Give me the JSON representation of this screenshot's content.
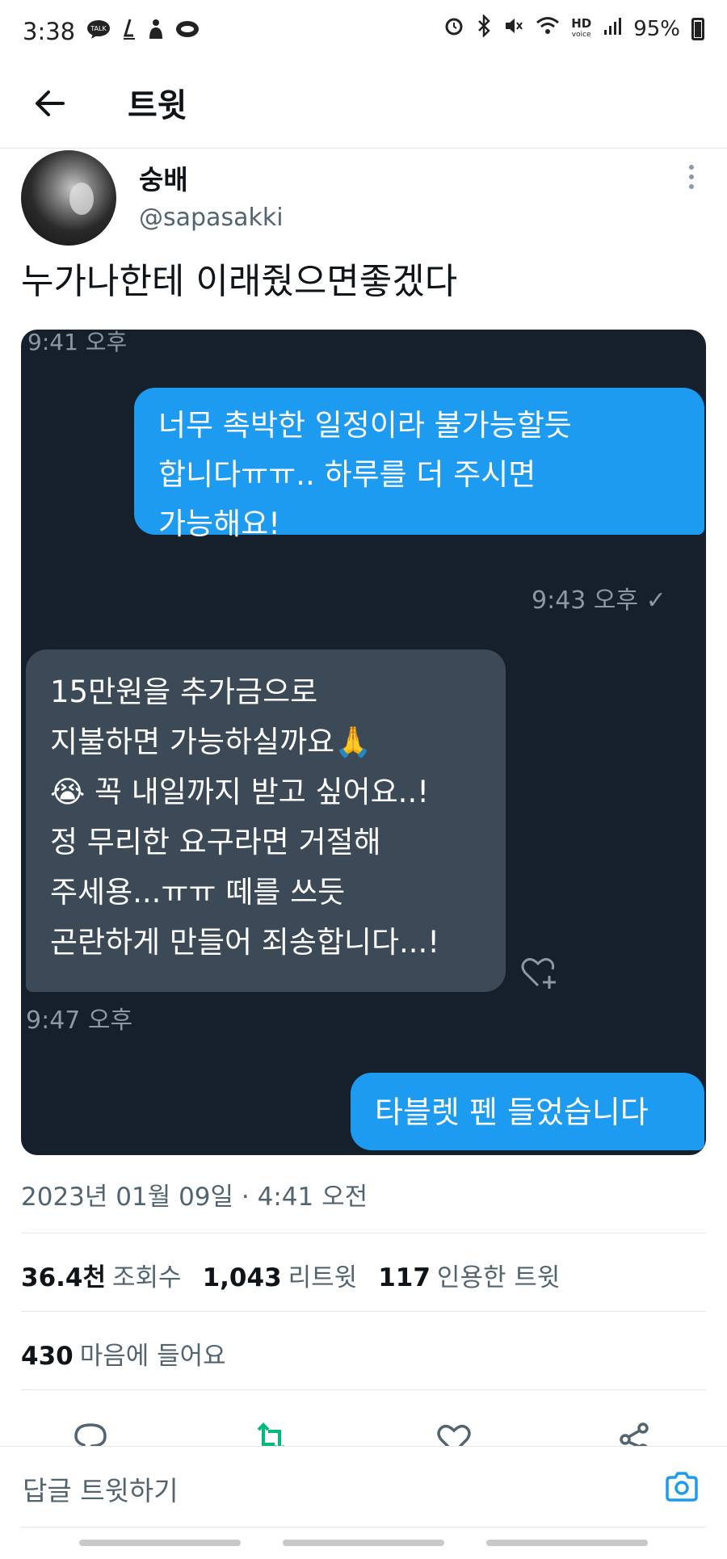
{
  "status_bar": {
    "time": "3:38",
    "left_icons": [
      "talk-icon",
      "l-icon",
      "person-icon",
      "bubble-icon"
    ],
    "right_icons": [
      "alarm-icon",
      "bluetooth-icon",
      "mute-icon",
      "wifi-icon",
      "hd-voice-icon",
      "signal-icon"
    ],
    "hd_text": "HD",
    "battery": "95%"
  },
  "header": {
    "title": "트윗"
  },
  "tweet": {
    "name": "숭배",
    "handle": "@sapasakki",
    "text": "누가나한테 이래줬으면좋겠다",
    "image": {
      "time_top": "9:41 오후",
      "out_msg_lines": [
        "너무 촉박한 일정이라 불가능할듯",
        "합니다ㅠㅠ.. 하루를 더 주시면",
        "가능해요!"
      ],
      "out_time": "9:43 오후 ✓",
      "in_msg_lines": [
        "15만원을 추가금으로",
        "지불하면 가능하실까요🙏",
        "😭 꼭 내일까지 받고 싶어요..!",
        "정 무리한 요구라면 거절해",
        "주세용...ㅠㅠ 떼를 쓰듯",
        "곤란하게 만들어 죄송합니다...!"
      ],
      "in_time": "9:47 오후",
      "out_msg2": "타블렛 펜 들었습니다"
    },
    "date": "2023년 01월 09일 · 4:41 오전",
    "stats": {
      "views_count": "36.4천",
      "views_label": "조회수",
      "retweets_count": "1,043",
      "retweets_label": "리트윗",
      "quotes_count": "117",
      "quotes_label": "인용한 트윗"
    },
    "likes": {
      "count": "430",
      "label": "마음에 들어요"
    }
  },
  "reply_bar": {
    "placeholder": "답글 트윗하기"
  },
  "colors": {
    "accent": "#1d9bf0",
    "retweet": "#00ba7c",
    "dm_bg": "#15202b",
    "in_bubble": "#3c4a58"
  }
}
